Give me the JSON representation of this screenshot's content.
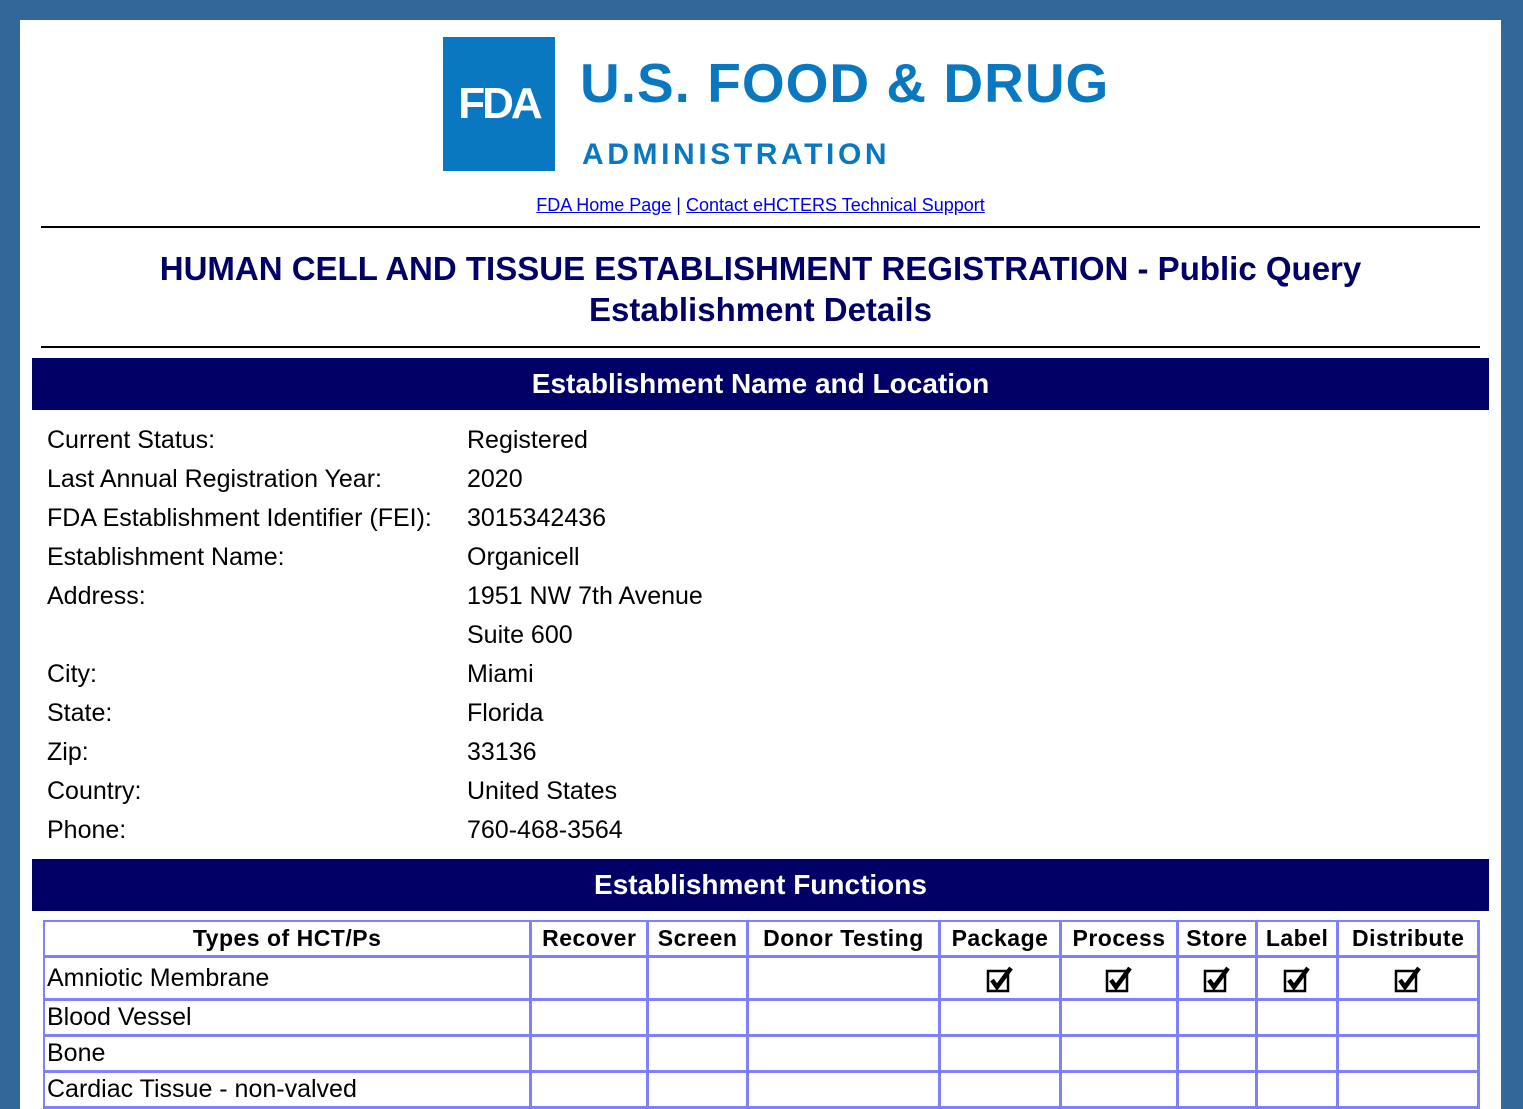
{
  "logo": {
    "mark": "FDA",
    "line1": "U.S. FOOD & DRUG",
    "line2": "ADMINISTRATION",
    "color": "#0a78c1"
  },
  "links": {
    "home": "FDA Home Page",
    "separator": "|",
    "support": "Contact eHCTERS Technical Support"
  },
  "title": {
    "line1": "HUMAN CELL AND TISSUE ESTABLISHMENT REGISTRATION - Public Query",
    "line2": "Establishment Details"
  },
  "sections": {
    "name_location": "Establishment Name and Location",
    "functions": "Establishment Functions"
  },
  "details": [
    {
      "label": "Current Status:",
      "value": "Registered"
    },
    {
      "label": "Last Annual Registration Year:",
      "value": "2020"
    },
    {
      "label": "FDA Establishment Identifier (FEI):",
      "value": "3015342436"
    },
    {
      "label": "Establishment Name:",
      "value": "Organicell"
    },
    {
      "label": "Address:",
      "value": "1951 NW 7th Avenue"
    },
    {
      "label": "",
      "value": "Suite 600"
    },
    {
      "label": "City:",
      "value": "Miami"
    },
    {
      "label": "State:",
      "value": "Florida"
    },
    {
      "label": "Zip:",
      "value": "33136"
    },
    {
      "label": "Country:",
      "value": "United States"
    },
    {
      "label": "Phone:",
      "value": "760-468-3564"
    }
  ],
  "functions_table": {
    "headers": [
      "Types of HCT/Ps",
      "Recover",
      "Screen",
      "Donor Testing",
      "Package",
      "Process",
      "Store",
      "Label",
      "Distribute"
    ],
    "rows": [
      {
        "type": "Amniotic Membrane",
        "checks": [
          false,
          false,
          false,
          true,
          true,
          true,
          true,
          true
        ]
      },
      {
        "type": "Blood Vessel",
        "checks": [
          false,
          false,
          false,
          false,
          false,
          false,
          false,
          false
        ]
      },
      {
        "type": "Bone",
        "checks": [
          false,
          false,
          false,
          false,
          false,
          false,
          false,
          false
        ]
      },
      {
        "type": "Cardiac Tissue - non-valved",
        "checks": [
          false,
          false,
          false,
          false,
          false,
          false,
          false,
          false
        ]
      },
      {
        "type": "",
        "checks": [
          false,
          false,
          false,
          false,
          false,
          false,
          false,
          false
        ]
      }
    ]
  },
  "colors": {
    "frame": "#336699",
    "section_bar": "#000066",
    "title": "#000066",
    "table_border": "#8080ff"
  }
}
